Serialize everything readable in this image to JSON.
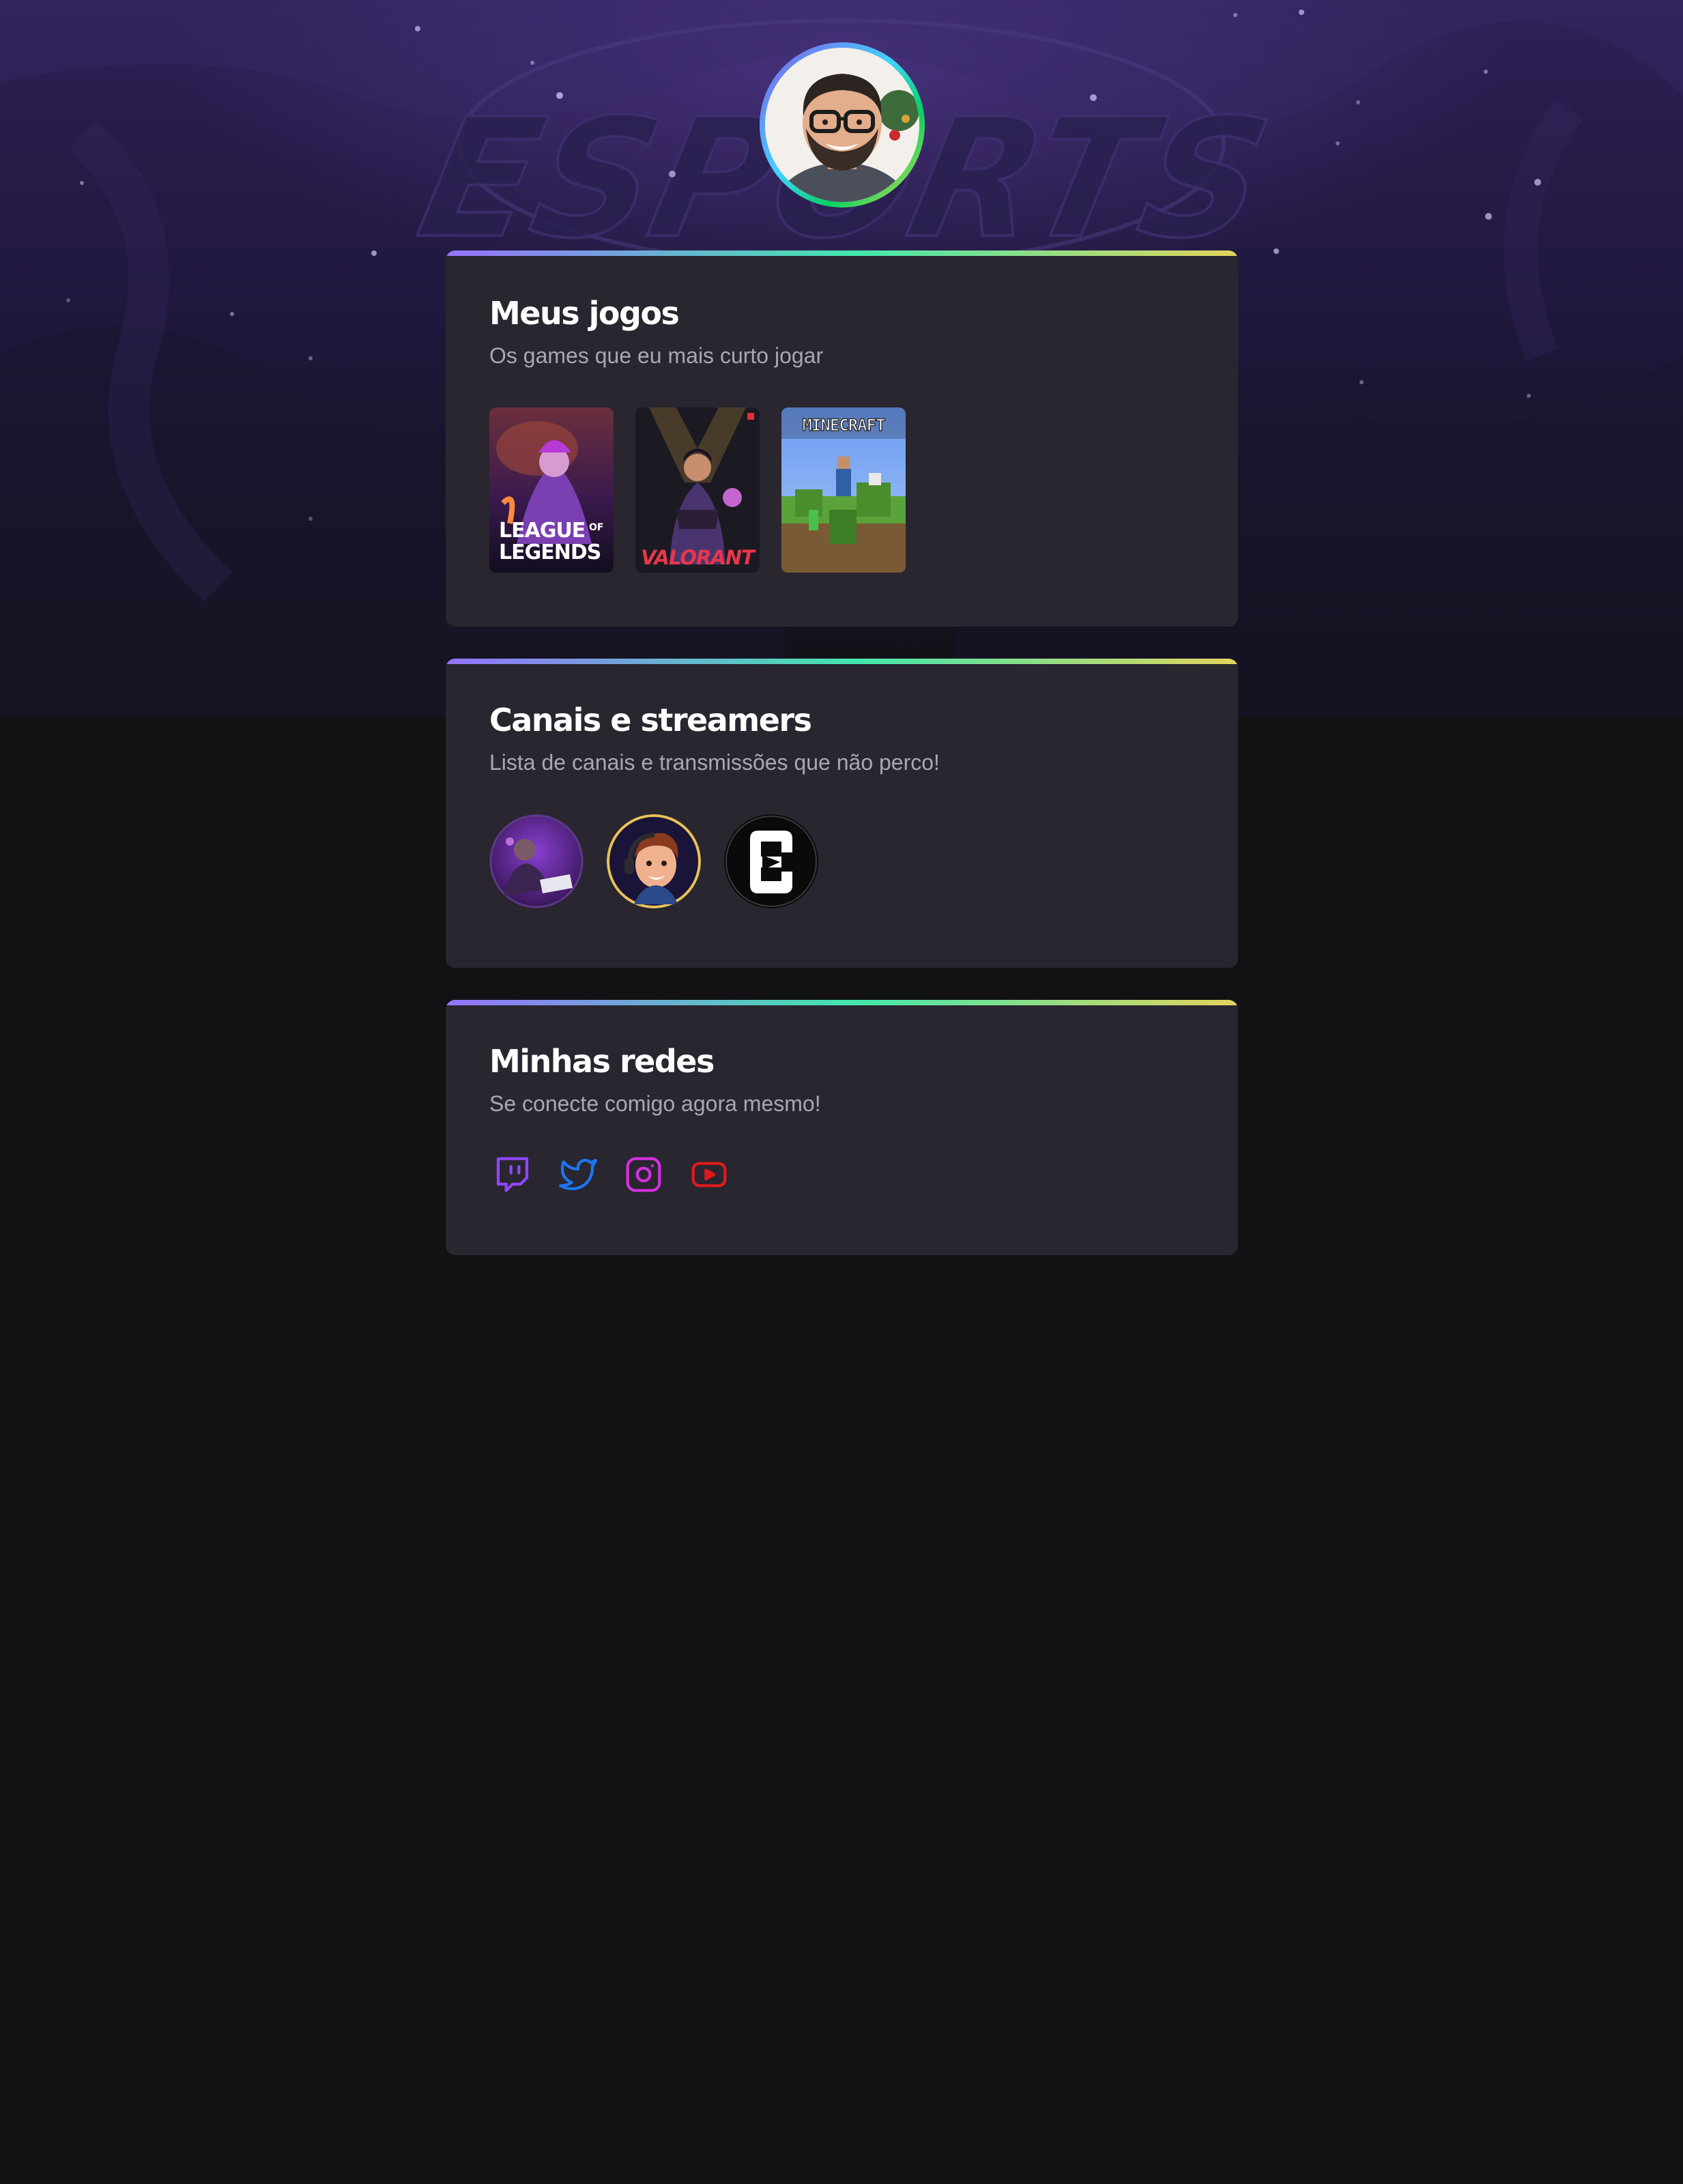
{
  "games_section": {
    "title": "Meus jogos",
    "subtitle": "Os games que eu mais curto jogar",
    "items": [
      {
        "name": "League of Legends",
        "art_line1": "LEAGUE",
        "art_of": "OF",
        "art_line2": "LEGENDS"
      },
      {
        "name": "Valorant",
        "art_text": "VALORANT"
      },
      {
        "name": "Minecraft",
        "art_text": "MINECRAFT"
      }
    ]
  },
  "channels_section": {
    "title": "Canais e streamers",
    "subtitle": "Lista de canais e transmissões que não perco!",
    "items": [
      {
        "icon": "streamer-avatar-1"
      },
      {
        "icon": "streamer-avatar-2"
      },
      {
        "icon": "streamer-avatar-3"
      }
    ]
  },
  "social_section": {
    "title": "Minhas redes",
    "subtitle": "Se conecte comigo agora mesmo!",
    "items": [
      {
        "icon": "twitch-icon",
        "color": "#9147ff"
      },
      {
        "icon": "twitter-icon",
        "color": "#1d76f2"
      },
      {
        "icon": "instagram-icon",
        "color": "#d62fe0"
      },
      {
        "icon": "youtube-icon",
        "color": "#e01a1a"
      }
    ]
  },
  "hero": {
    "background_text": "ESPORTS"
  }
}
